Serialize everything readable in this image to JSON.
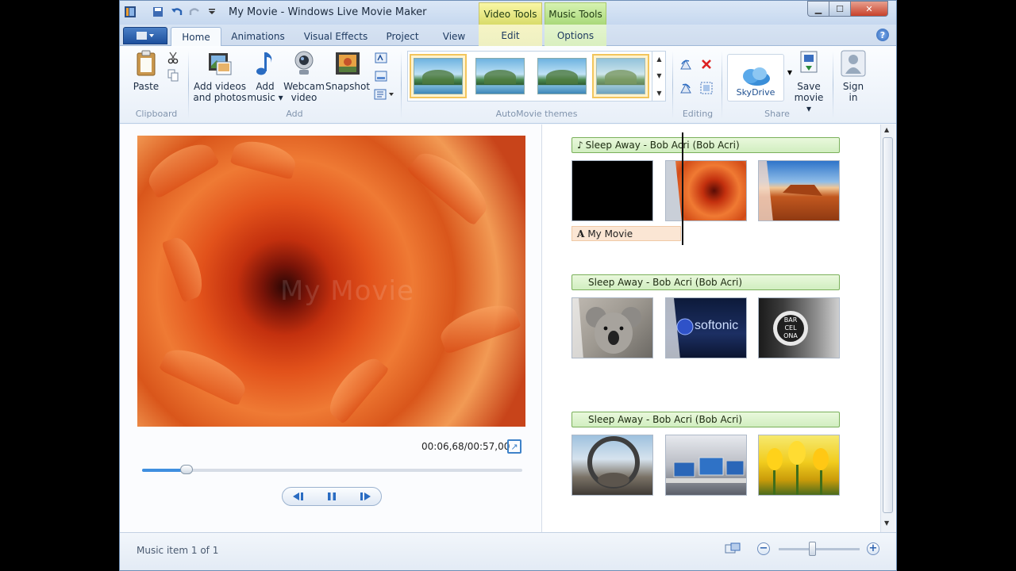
{
  "window": {
    "title": "My Movie - Windows Live Movie Maker",
    "context_tabs": {
      "video_tools": "Video Tools",
      "music_tools": "Music Tools"
    },
    "controls": {
      "minimize": "▁",
      "maximize": "☐",
      "close": "✕"
    }
  },
  "tabs": [
    "Home",
    "Animations",
    "Visual Effects",
    "Project",
    "View"
  ],
  "context_subtabs": {
    "edit": "Edit",
    "options": "Options"
  },
  "help_label": "?",
  "ribbon": {
    "clipboard": {
      "paste_label": "Paste",
      "group_label": "Clipboard"
    },
    "add": {
      "add_videos_label": "Add videos",
      "add_videos_label2": "and photos",
      "add_music_label": "Add",
      "add_music_label2": "music ▾",
      "webcam_label": "Webcam",
      "webcam_label2": "video",
      "snapshot_label": "Snapshot",
      "group_label": "Add"
    },
    "themes": {
      "group_label": "AutoMovie themes",
      "count": 4,
      "selected_index": 0
    },
    "editing": {
      "group_label": "Editing"
    },
    "share": {
      "skydrive_label": "SkyDrive",
      "save_movie_label": "Save",
      "save_movie_label2": "movie ▾",
      "sign_in_label": "Sign",
      "sign_in_label2": "in",
      "group_label": "Share"
    }
  },
  "preview": {
    "watermark": "My Movie",
    "timecode": "00:06,68/00:57,00",
    "progress_fraction": 0.117
  },
  "storyboard": {
    "music_rows": [
      {
        "label": "Sleep Away - Bob Acri (Bob Acri)",
        "has_note_icon": true
      },
      {
        "label": "Sleep Away - Bob Acri (Bob Acri)",
        "has_note_icon": false
      },
      {
        "label": "Sleep Away - Bob Acri (Bob Acri)",
        "has_note_icon": false
      }
    ],
    "caption": "My Movie",
    "clip_logo_text": "softonic",
    "clip_sign_lines": [
      "BAR",
      "CEL",
      "ONA"
    ]
  },
  "statusbar": {
    "text": "Music item 1 of 1",
    "zoom_fraction": 0.42
  },
  "colors": {
    "accent": "#3f8fe0",
    "music_bar": "#d1eec0",
    "caption_bar": "#fbe6d4"
  }
}
